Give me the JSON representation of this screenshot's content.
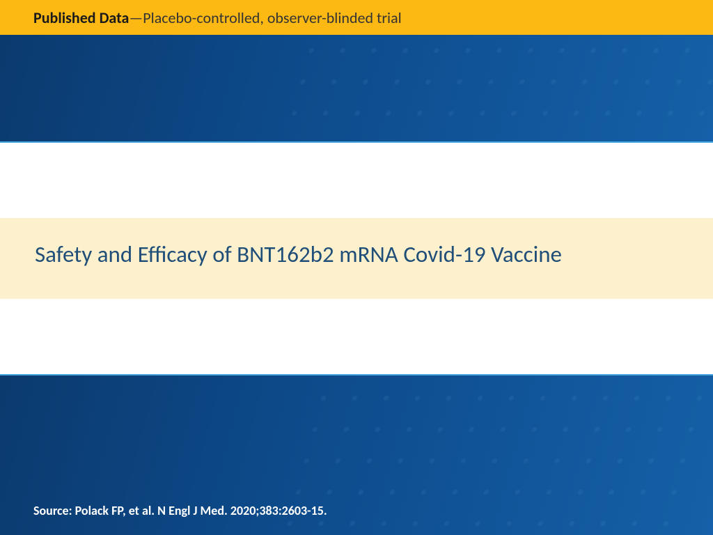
{
  "header": {
    "label": "Published Data",
    "separator": " —",
    "description": "Placebo-controlled, observer-blinded trial"
  },
  "title": "Safety and Efficacy of BNT162b2 mRNA Covid-19 Vaccine",
  "source": "Source: Polack FP, et al. N Engl J Med. 2020;383:2603-15."
}
